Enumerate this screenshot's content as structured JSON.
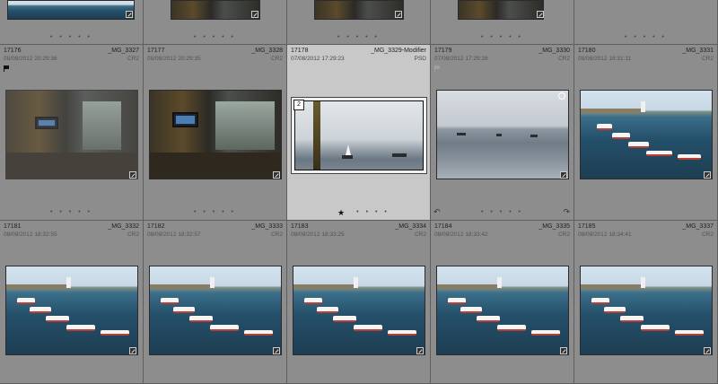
{
  "grid": {
    "top_row": [
      {
        "dots": "• • • • •"
      },
      {
        "dots": "• • • • •"
      },
      {
        "dots": "• • • • •"
      },
      {
        "dots": "• • • • •"
      },
      {
        "dots": "• • • • •"
      }
    ],
    "row1": [
      {
        "num": "17176",
        "file": "_MG_3327",
        "date": "08/08/2012 20:29:36",
        "ext": "CR2",
        "dots": "• • • • •",
        "flag": "flag-icon"
      },
      {
        "num": "17177",
        "file": "_MG_3328",
        "date": "08/08/2012 20:29:35",
        "ext": "CR2",
        "dots": "• • • • •"
      },
      {
        "num": "17178",
        "file": "_MG_3329-Modifier",
        "date": "07/08/2012 17:29:23",
        "ext": "PSD",
        "dots": "• • • •",
        "stack_count": "2",
        "rating_star": "★"
      },
      {
        "num": "17179",
        "file": "_MG_3330",
        "date": "07/08/2012 17:29:28",
        "ext": "CR2",
        "dots": "• • • • •",
        "flag": "flag-icon"
      },
      {
        "num": "17180",
        "file": "_MG_3331",
        "date": "08/08/2012 18:31:11",
        "ext": "CR2",
        "dots": ""
      }
    ],
    "row2": [
      {
        "num": "17181",
        "file": "_MG_3332",
        "date": "08/08/2012 18:32:55",
        "ext": "CR2"
      },
      {
        "num": "17182",
        "file": "_MG_3333",
        "date": "08/08/2012 18:32:57",
        "ext": "CR2"
      },
      {
        "num": "17183",
        "file": "_MG_3334",
        "date": "08/08/2012 18:33:25",
        "ext": "CR2"
      },
      {
        "num": "17184",
        "file": "_MG_3335",
        "date": "08/08/2012 18:33:42",
        "ext": "CR2"
      },
      {
        "num": "17185",
        "file": "_MG_3337",
        "date": "08/08/2012 18:34:41",
        "ext": "CR2"
      }
    ]
  },
  "icons": {
    "rotate_left": "↶",
    "rotate_right": "↷"
  },
  "colors": {
    "cell_bg": "#8d8d8d",
    "selected_bg": "#c8c8c8",
    "gutter": "#5e5e5e"
  }
}
